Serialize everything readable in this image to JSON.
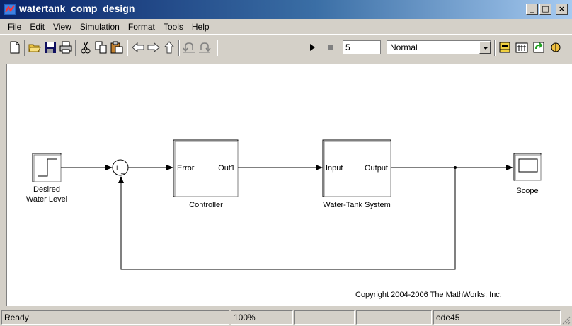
{
  "window": {
    "title": "watertank_comp_design",
    "controls": {
      "minimize": "_",
      "maximize": "□",
      "close": "×"
    }
  },
  "menubar": {
    "items": [
      "File",
      "Edit",
      "View",
      "Simulation",
      "Format",
      "Tools",
      "Help"
    ]
  },
  "toolbar": {
    "stop_time": "5",
    "sim_mode": "Normal",
    "icons": [
      "new-icon",
      "open-icon",
      "save-icon",
      "print-icon",
      "cut-icon",
      "copy-icon",
      "paste-icon",
      "back-icon",
      "forward-icon",
      "up-icon",
      "undo-icon",
      "redo-icon",
      "play-icon",
      "stop-icon",
      "build-icon",
      "library-icon",
      "update-icon",
      "debug-icon"
    ]
  },
  "diagram": {
    "blocks": {
      "step": {
        "label_line1": "Desired",
        "label_line2": "Water Level"
      },
      "sum": {
        "plus": "+",
        "minus": "_"
      },
      "controller": {
        "in_port": "Error",
        "out_port": "Out1",
        "label": "Controller"
      },
      "plant": {
        "in_port": "Input",
        "out_port": "Output",
        "label": "Water-Tank System"
      },
      "scope": {
        "label": "Scope"
      }
    },
    "copyright": "Copyright 2004-2006 The MathWorks, Inc."
  },
  "statusbar": {
    "status": "Ready",
    "zoom": "100%",
    "solver": "ode45"
  },
  "colors": {
    "title_active": "#0a246a",
    "face": "#d4d0c8",
    "canvas": "#ffffff"
  }
}
